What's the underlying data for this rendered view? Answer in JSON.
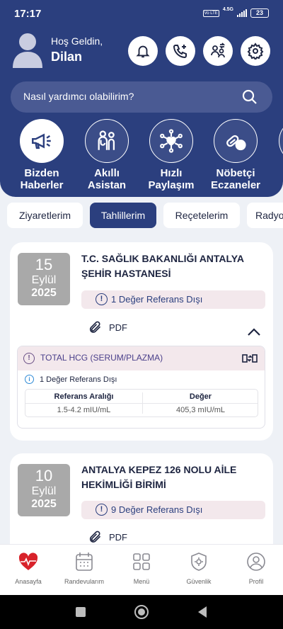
{
  "status_bar": {
    "time": "17:17",
    "network_badge": "Vo LTE",
    "network_type": "4.5G",
    "battery": "23"
  },
  "header": {
    "greeting": "Hoş Geldin,",
    "user_name": "Dilan"
  },
  "header_buttons": [
    "bell-icon",
    "phone-plus-icon",
    "users-switch-icon",
    "gear-icon"
  ],
  "search": {
    "placeholder": "Nasıl yardımcı olabilirim?"
  },
  "quick_actions": [
    {
      "line1": "Bizden",
      "line2": "Haberler",
      "icon": "megaphone-icon"
    },
    {
      "line1": "Akıllı",
      "line2": "Asistan",
      "icon": "doctor-patient-icon"
    },
    {
      "line1": "Hızlı",
      "line2": "Paylaşım",
      "icon": "share-heart-icon"
    },
    {
      "line1": "Nöbetçi",
      "line2": "Eczaneler",
      "icon": "pill-icon"
    }
  ],
  "tabs": [
    {
      "label": "Ziyaretlerim",
      "active": false
    },
    {
      "label": "Tahlillerim",
      "active": true
    },
    {
      "label": "Reçetelerim",
      "active": false
    },
    {
      "label": "Radyo",
      "active": false
    }
  ],
  "visits": [
    {
      "day": "15",
      "month": "Eylül",
      "year": "2025",
      "hospital_line1": "T.C. SAĞLIK BAKANLIĞI ANTALYA",
      "hospital_line2": "ŞEHİR HASTANESİ",
      "reference_status": "1 Değer Referans Dışı",
      "pdf_label": "PDF",
      "result": {
        "test_name": "TOTAL HCG (SERUM/PLAZMA)",
        "sub_status": "1 Değer Referans Dışı",
        "col1_header": "Referans Aralığı",
        "col2_header": "Değer",
        "col1_value": "1.5-4.2 mIU/mL",
        "col2_value": "405,3 mIU/mL"
      }
    },
    {
      "day": "10",
      "month": "Eylül",
      "year": "2025",
      "hospital_line1": "ANTALYA KEPEZ 126 NOLU AİLE",
      "hospital_line2": "HEKİMLİĞİ BİRİMİ",
      "reference_status": "9 Değer Referans Dışı",
      "pdf_label": "PDF"
    }
  ],
  "bottom_nav": [
    {
      "label": "Anasayfa",
      "icon": "heart-home-icon",
      "active": true
    },
    {
      "label": "Randevularım",
      "icon": "calendar-icon",
      "active": false
    },
    {
      "label": "Menü",
      "icon": "grid-menu-icon",
      "active": false
    },
    {
      "label": "Güvenlik",
      "icon": "shield-gear-icon",
      "active": false
    },
    {
      "label": "Profil",
      "icon": "profile-icon",
      "active": false
    }
  ],
  "colors": {
    "primary": "#2b3f7e",
    "accent_red": "#d8222a",
    "badge_bg": "#f3e8ec"
  }
}
